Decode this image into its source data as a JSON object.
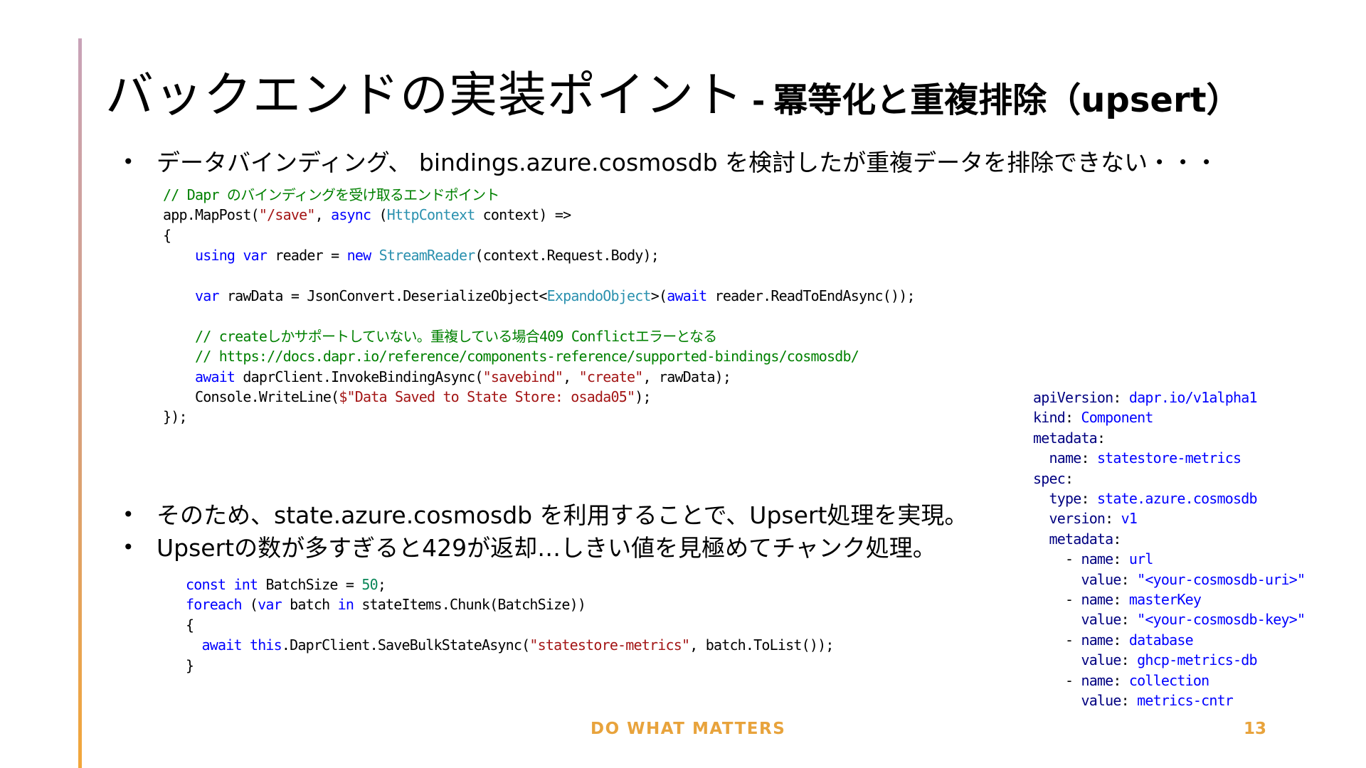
{
  "slide": {
    "title_main": "バックエンドの実装ポイント",
    "title_separator": "-",
    "title_sub": "冪等化と重複排除（upsert）",
    "bullet_symbol": "•",
    "bullets": [
      "データバインディング、 bindings.azure.cosmosdb を検討したが重複データを排除できない・・・",
      "そのため、state.azure.cosmosdb を利用することで、Upsert処理を実現。",
      "Upsertの数が多すぎると429が返却…しきい値を見極めてチャンク処理。"
    ],
    "footer": "DO WHAT MATTERS",
    "page_number": "13",
    "accent_color": "#e8a33c"
  },
  "code_binding": [
    [
      {
        "t": "// Dapr のバインディングを受け取るエンドポイント",
        "c": "cm"
      }
    ],
    [
      {
        "t": "app.MapPost("
      },
      {
        "t": "\"/save\"",
        "c": "st"
      },
      {
        "t": ", "
      },
      {
        "t": "async",
        "c": "kw"
      },
      {
        "t": " ("
      },
      {
        "t": "HttpContext",
        "c": "ty"
      },
      {
        "t": " context) =>"
      }
    ],
    [
      {
        "t": "{"
      }
    ],
    [
      {
        "t": "    "
      },
      {
        "t": "using",
        "c": "kw"
      },
      {
        "t": " "
      },
      {
        "t": "var",
        "c": "kw"
      },
      {
        "t": " reader = "
      },
      {
        "t": "new",
        "c": "kw"
      },
      {
        "t": " "
      },
      {
        "t": "StreamReader",
        "c": "ty"
      },
      {
        "t": "(context.Request.Body);"
      }
    ],
    [],
    [
      {
        "t": "    "
      },
      {
        "t": "var",
        "c": "kw"
      },
      {
        "t": " rawData = JsonConvert.DeserializeObject<"
      },
      {
        "t": "ExpandoObject",
        "c": "ty"
      },
      {
        "t": ">("
      },
      {
        "t": "await",
        "c": "kw"
      },
      {
        "t": " reader.ReadToEndAsync());"
      }
    ],
    [],
    [
      {
        "t": "    "
      },
      {
        "t": "// createしかサポートしていない。重複している場合409 Conflictエラーとなる",
        "c": "cm"
      }
    ],
    [
      {
        "t": "    "
      },
      {
        "t": "// https://docs.dapr.io/reference/components-reference/supported-bindings/cosmosdb/",
        "c": "cm"
      }
    ],
    [
      {
        "t": "    "
      },
      {
        "t": "await",
        "c": "kw"
      },
      {
        "t": " daprClient.InvokeBindingAsync("
      },
      {
        "t": "\"savebind\"",
        "c": "st"
      },
      {
        "t": ", "
      },
      {
        "t": "\"create\"",
        "c": "st"
      },
      {
        "t": ", rawData);"
      }
    ],
    [
      {
        "t": "    Console.WriteLine("
      },
      {
        "t": "$\"Data Saved to State Store: osada05\"",
        "c": "st"
      },
      {
        "t": ");"
      }
    ],
    [
      {
        "t": "});"
      }
    ]
  ],
  "code_chunk": [
    [
      {
        "t": "const",
        "c": "kw"
      },
      {
        "t": " "
      },
      {
        "t": "int",
        "c": "kw"
      },
      {
        "t": " BatchSize = "
      },
      {
        "t": "50",
        "c": "num"
      },
      {
        "t": ";"
      }
    ],
    [
      {
        "t": "foreach",
        "c": "kw"
      },
      {
        "t": " ("
      },
      {
        "t": "var",
        "c": "kw"
      },
      {
        "t": " batch "
      },
      {
        "t": "in",
        "c": "kw"
      },
      {
        "t": " stateItems.Chunk(BatchSize))"
      }
    ],
    [
      {
        "t": "{"
      }
    ],
    [
      {
        "t": "  "
      },
      {
        "t": "await",
        "c": "kw"
      },
      {
        "t": " "
      },
      {
        "t": "this",
        "c": "kw"
      },
      {
        "t": ".DaprClient.SaveBulkStateAsync("
      },
      {
        "t": "\"statestore-metrics\"",
        "c": "st"
      },
      {
        "t": ", batch.ToList());"
      }
    ],
    [
      {
        "t": "}"
      }
    ]
  ],
  "code_yaml": [
    [
      {
        "t": "apiVersion",
        "c": "yk"
      },
      {
        "t": ": "
      },
      {
        "t": "dapr.io/v1alpha1",
        "c": "yv"
      }
    ],
    [
      {
        "t": "kind",
        "c": "yk"
      },
      {
        "t": ": "
      },
      {
        "t": "Component",
        "c": "yv"
      }
    ],
    [
      {
        "t": "metadata",
        "c": "yk"
      },
      {
        "t": ":"
      }
    ],
    [
      {
        "t": "  "
      },
      {
        "t": "name",
        "c": "yk"
      },
      {
        "t": ": "
      },
      {
        "t": "statestore-metrics",
        "c": "yv"
      }
    ],
    [
      {
        "t": "spec",
        "c": "yk"
      },
      {
        "t": ":"
      }
    ],
    [
      {
        "t": "  "
      },
      {
        "t": "type",
        "c": "yk"
      },
      {
        "t": ": "
      },
      {
        "t": "state.azure.cosmosdb",
        "c": "yv"
      }
    ],
    [
      {
        "t": "  "
      },
      {
        "t": "version",
        "c": "yk"
      },
      {
        "t": ": "
      },
      {
        "t": "v1",
        "c": "yv"
      }
    ],
    [
      {
        "t": "  "
      },
      {
        "t": "metadata",
        "c": "yk"
      },
      {
        "t": ":"
      }
    ],
    [
      {
        "t": "    - "
      },
      {
        "t": "name",
        "c": "yk"
      },
      {
        "t": ": "
      },
      {
        "t": "url",
        "c": "yv"
      }
    ],
    [
      {
        "t": "      "
      },
      {
        "t": "value",
        "c": "yk"
      },
      {
        "t": ": "
      },
      {
        "t": "\"<your-cosmosdb-uri>\"",
        "c": "yv"
      }
    ],
    [
      {
        "t": "    - "
      },
      {
        "t": "name",
        "c": "yk"
      },
      {
        "t": ": "
      },
      {
        "t": "masterKey",
        "c": "yv"
      }
    ],
    [
      {
        "t": "      "
      },
      {
        "t": "value",
        "c": "yk"
      },
      {
        "t": ": "
      },
      {
        "t": "\"<your-cosmosdb-key>\"",
        "c": "yv"
      }
    ],
    [
      {
        "t": "    - "
      },
      {
        "t": "name",
        "c": "yk"
      },
      {
        "t": ": "
      },
      {
        "t": "database",
        "c": "yv"
      }
    ],
    [
      {
        "t": "      "
      },
      {
        "t": "value",
        "c": "yk"
      },
      {
        "t": ": "
      },
      {
        "t": "ghcp-metrics-db",
        "c": "yv"
      }
    ],
    [
      {
        "t": "    - "
      },
      {
        "t": "name",
        "c": "yk"
      },
      {
        "t": ": "
      },
      {
        "t": "collection",
        "c": "yv"
      }
    ],
    [
      {
        "t": "      "
      },
      {
        "t": "value",
        "c": "yk"
      },
      {
        "t": ": "
      },
      {
        "t": "metrics-cntr",
        "c": "yv"
      }
    ]
  ]
}
